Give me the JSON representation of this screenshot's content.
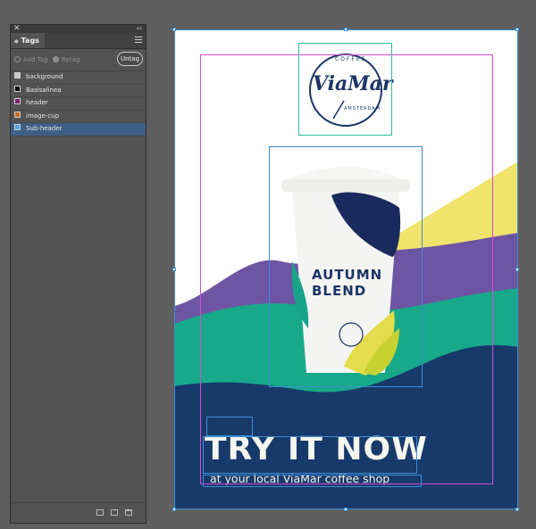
{
  "panel": {
    "close_glyph": "✕",
    "collapse_glyph": "‹‹",
    "tab_label": "Tags",
    "toolbar": {
      "add_tag": "Add Tag",
      "retag": "Retag",
      "untag": "Untag"
    },
    "tags": [
      {
        "label": "background",
        "color": "#c8c8c8"
      },
      {
        "label": "Basisalinea",
        "color": "#000000"
      },
      {
        "label": "header",
        "color": "#7a1c6f"
      },
      {
        "label": "image-cup",
        "color": "#c56a1f"
      },
      {
        "label": "Sub-header",
        "color": "#4aa3d6"
      }
    ],
    "selected_tag": "Sub-header"
  },
  "artboard": {
    "logo": {
      "top_text": "COFFEE",
      "brand": "ViaMar",
      "bottom_text": "AMSTERDAM"
    },
    "cup_text_line1": "AUTUMN",
    "cup_text_line2": "BLEND",
    "headline": "TRY IT NOW",
    "subheader": "at your local ViaMar coffee shop",
    "colors": {
      "navy": "#173a6b",
      "teal": "#17a98a",
      "purple": "#6e55a3",
      "yellow": "#f0e46d",
      "frame_magenta": "#d44ad4",
      "frame_blue": "#3d8ed6",
      "frame_teal": "#2fbf9a"
    }
  }
}
